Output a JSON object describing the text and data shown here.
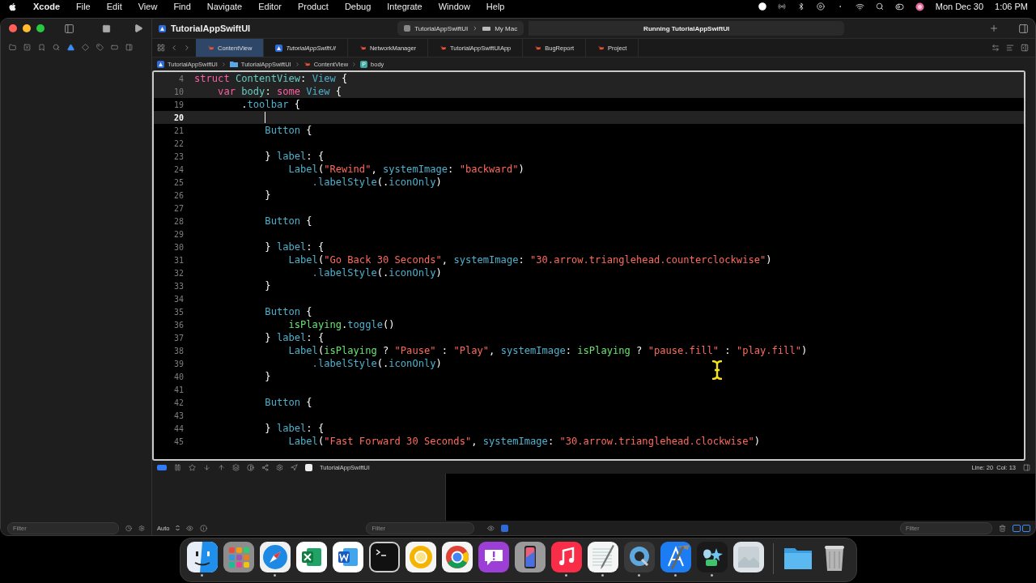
{
  "menu_bar": {
    "app_name": "Xcode",
    "menus": [
      "File",
      "Edit",
      "View",
      "Find",
      "Navigate",
      "Editor",
      "Product",
      "Debug",
      "Integrate",
      "Window",
      "Help"
    ],
    "date": "Mon Dec 30",
    "time": "1:06 PM"
  },
  "window": {
    "title": "TutorialAppSwiftUI",
    "scheme": {
      "target": "TutorialAppSwiftUI",
      "destination": "My Mac"
    },
    "activity": "Running TutorialAppSwiftUI"
  },
  "tabs": [
    {
      "label": "ContentView",
      "kind": "swift",
      "selected": true,
      "preview": false
    },
    {
      "label": "TutorialAppSwiftUI",
      "kind": "app",
      "selected": false,
      "preview": true
    },
    {
      "label": "NetworkManager",
      "kind": "swift",
      "selected": false,
      "preview": false
    },
    {
      "label": "TutorialAppSwiftUIApp",
      "kind": "swift",
      "selected": false,
      "preview": false
    },
    {
      "label": "BugReport",
      "kind": "swift",
      "selected": false,
      "preview": false
    },
    {
      "label": "Project",
      "kind": "swift",
      "selected": false,
      "preview": false
    }
  ],
  "breadcrumb": [
    {
      "label": "TutorialAppSwiftUI",
      "kind": "app"
    },
    {
      "label": "TutorialAppSwiftUI",
      "kind": "folder"
    },
    {
      "label": "ContentView",
      "kind": "swift"
    },
    {
      "label": "body",
      "kind": "property",
      "badge": "P"
    }
  ],
  "editor": {
    "sticky_lines": [
      {
        "number": "4",
        "tokens": [
          {
            "kind": "keyword",
            "text": "struct "
          },
          {
            "kind": "decl",
            "text": "ContentView"
          },
          {
            "kind": "plain",
            "text": ": "
          },
          {
            "kind": "type",
            "text": "View"
          },
          {
            "kind": "plain",
            "text": " {"
          }
        ]
      },
      {
        "number": "10",
        "tokens": [
          {
            "kind": "keyword",
            "text": "    var "
          },
          {
            "kind": "decl",
            "text": "body"
          },
          {
            "kind": "plain",
            "text": ": "
          },
          {
            "kind": "keyword",
            "text": "some "
          },
          {
            "kind": "type",
            "text": "View"
          },
          {
            "kind": "plain",
            "text": " {"
          }
        ]
      }
    ],
    "lines": [
      {
        "number": "19",
        "current": false,
        "tokens": [
          {
            "kind": "plain",
            "text": "        ."
          },
          {
            "kind": "type",
            "text": "toolbar"
          },
          {
            "kind": "plain",
            "text": " {"
          }
        ]
      },
      {
        "number": "20",
        "current": true
      },
      {
        "number": "21",
        "current": false,
        "tokens": [
          {
            "kind": "type",
            "text": "            Button"
          },
          {
            "kind": "plain",
            "text": " {"
          }
        ]
      },
      {
        "number": "22",
        "current": false
      },
      {
        "number": "23",
        "current": false,
        "tokens": [
          {
            "kind": "plain",
            "text": "            } "
          },
          {
            "kind": "type",
            "text": "label"
          },
          {
            "kind": "plain",
            "text": ": {"
          }
        ]
      },
      {
        "number": "24",
        "current": false,
        "tokens": [
          {
            "kind": "type",
            "text": "                Label"
          },
          {
            "kind": "plain",
            "text": "("
          },
          {
            "kind": "string",
            "text": "\"Rewind\""
          },
          {
            "kind": "plain",
            "text": ", "
          },
          {
            "kind": "type",
            "text": "systemImage"
          },
          {
            "kind": "plain",
            "text": ": "
          },
          {
            "kind": "string",
            "text": "\"backward\""
          },
          {
            "kind": "plain",
            "text": ")"
          }
        ]
      },
      {
        "number": "25",
        "current": false,
        "tokens": [
          {
            "kind": "type",
            "text": "                    .labelStyle"
          },
          {
            "kind": "plain",
            "text": "(."
          },
          {
            "kind": "type",
            "text": "iconOnly"
          },
          {
            "kind": "plain",
            "text": ")"
          }
        ]
      },
      {
        "number": "26",
        "current": false,
        "tokens": [
          {
            "kind": "plain",
            "text": "            }"
          }
        ]
      },
      {
        "number": "27",
        "current": false
      },
      {
        "number": "28",
        "current": false,
        "tokens": [
          {
            "kind": "type",
            "text": "            Button"
          },
          {
            "kind": "plain",
            "text": " {"
          }
        ]
      },
      {
        "number": "29",
        "current": false
      },
      {
        "number": "30",
        "current": false,
        "tokens": [
          {
            "kind": "plain",
            "text": "            } "
          },
          {
            "kind": "type",
            "text": "label"
          },
          {
            "kind": "plain",
            "text": ": {"
          }
        ]
      },
      {
        "number": "31",
        "current": false,
        "tokens": [
          {
            "kind": "type",
            "text": "                Label"
          },
          {
            "kind": "plain",
            "text": "("
          },
          {
            "kind": "string",
            "text": "\"Go Back 30 Seconds\""
          },
          {
            "kind": "plain",
            "text": ", "
          },
          {
            "kind": "type",
            "text": "systemImage"
          },
          {
            "kind": "plain",
            "text": ": "
          },
          {
            "kind": "string",
            "text": "\"30.arrow.trianglehead.counterclockwise\""
          },
          {
            "kind": "plain",
            "text": ")"
          }
        ]
      },
      {
        "number": "32",
        "current": false,
        "tokens": [
          {
            "kind": "type",
            "text": "                    .labelStyle"
          },
          {
            "kind": "plain",
            "text": "(."
          },
          {
            "kind": "type",
            "text": "iconOnly"
          },
          {
            "kind": "plain",
            "text": ")"
          }
        ]
      },
      {
        "number": "33",
        "current": false,
        "tokens": [
          {
            "kind": "plain",
            "text": "            }"
          }
        ]
      },
      {
        "number": "34",
        "current": false
      },
      {
        "number": "35",
        "current": false,
        "tokens": [
          {
            "kind": "type",
            "text": "            Button"
          },
          {
            "kind": "plain",
            "text": " {"
          }
        ]
      },
      {
        "number": "36",
        "current": false,
        "tokens": [
          {
            "kind": "var",
            "text": "                isPlaying"
          },
          {
            "kind": "plain",
            "text": "."
          },
          {
            "kind": "type",
            "text": "toggle"
          },
          {
            "kind": "plain",
            "text": "()"
          }
        ]
      },
      {
        "number": "37",
        "current": false,
        "tokens": [
          {
            "kind": "plain",
            "text": "            } "
          },
          {
            "kind": "type",
            "text": "label"
          },
          {
            "kind": "plain",
            "text": ": {"
          }
        ]
      },
      {
        "number": "38",
        "current": false,
        "tokens": [
          {
            "kind": "type",
            "text": "                Label"
          },
          {
            "kind": "plain",
            "text": "("
          },
          {
            "kind": "var",
            "text": "isPlaying"
          },
          {
            "kind": "plain",
            "text": " ? "
          },
          {
            "kind": "string",
            "text": "\"Pause\""
          },
          {
            "kind": "plain",
            "text": " : "
          },
          {
            "kind": "string",
            "text": "\"Play\""
          },
          {
            "kind": "plain",
            "text": ", "
          },
          {
            "kind": "type",
            "text": "systemImage"
          },
          {
            "kind": "plain",
            "text": ": "
          },
          {
            "kind": "var",
            "text": "isPlaying"
          },
          {
            "kind": "plain",
            "text": " ? "
          },
          {
            "kind": "string",
            "text": "\"pause.fill\""
          },
          {
            "kind": "plain",
            "text": " : "
          },
          {
            "kind": "string",
            "text": "\"play.fill\""
          },
          {
            "kind": "plain",
            "text": ")"
          }
        ]
      },
      {
        "number": "39",
        "current": false,
        "tokens": [
          {
            "kind": "type",
            "text": "                    .labelStyle"
          },
          {
            "kind": "plain",
            "text": "(."
          },
          {
            "kind": "type",
            "text": "iconOnly"
          },
          {
            "kind": "plain",
            "text": ")"
          }
        ]
      },
      {
        "number": "40",
        "current": false,
        "tokens": [
          {
            "kind": "plain",
            "text": "            }"
          }
        ]
      },
      {
        "number": "41",
        "current": false
      },
      {
        "number": "42",
        "current": false,
        "tokens": [
          {
            "kind": "type",
            "text": "            Button"
          },
          {
            "kind": "plain",
            "text": " {"
          }
        ]
      },
      {
        "number": "43",
        "current": false
      },
      {
        "number": "44",
        "current": false,
        "tokens": [
          {
            "kind": "plain",
            "text": "            } "
          },
          {
            "kind": "type",
            "text": "label"
          },
          {
            "kind": "plain",
            "text": ": {"
          }
        ]
      },
      {
        "number": "45",
        "current": false,
        "tokens": [
          {
            "kind": "type",
            "text": "                Label"
          },
          {
            "kind": "plain",
            "text": "("
          },
          {
            "kind": "string",
            "text": "\"Fast Forward 30 Seconds\""
          },
          {
            "kind": "plain",
            "text": ", "
          },
          {
            "kind": "type",
            "text": "systemImage"
          },
          {
            "kind": "plain",
            "text": ": "
          },
          {
            "kind": "string",
            "text": "\"30.arrow.trianglehead.clockwise\""
          },
          {
            "kind": "plain",
            "text": ")"
          }
        ]
      }
    ]
  },
  "debug_bar": {
    "process": "TutorialAppSwiftUI",
    "position": "Line: 20  Col: 13"
  },
  "debug_area": {
    "mode": "Auto",
    "variables_filter": {
      "placeholder": "Filter"
    },
    "console_filter": {
      "placeholder": "Filter"
    }
  },
  "navigator_filter": {
    "placeholder": "Filter"
  },
  "dock": [
    {
      "kind": "finder",
      "running": true
    },
    {
      "kind": "launchpad",
      "running": false
    },
    {
      "kind": "safari",
      "running": true
    },
    {
      "kind": "excel",
      "running": false
    },
    {
      "kind": "word",
      "running": false
    },
    {
      "kind": "terminal",
      "running": false
    },
    {
      "kind": "canary",
      "running": false
    },
    {
      "kind": "chrome",
      "running": false
    },
    {
      "kind": "feedback",
      "running": false
    },
    {
      "kind": "phone",
      "running": false
    },
    {
      "kind": "music",
      "running": true
    },
    {
      "kind": "textedit",
      "running": true
    },
    {
      "kind": "quicktime",
      "running": true
    },
    {
      "kind": "xcode",
      "running": true
    },
    {
      "kind": "creator",
      "running": true
    },
    {
      "kind": "preview",
      "running": false
    },
    {
      "kind": "separator"
    },
    {
      "kind": "folder",
      "running": false
    },
    {
      "kind": "trash",
      "running": false
    }
  ]
}
